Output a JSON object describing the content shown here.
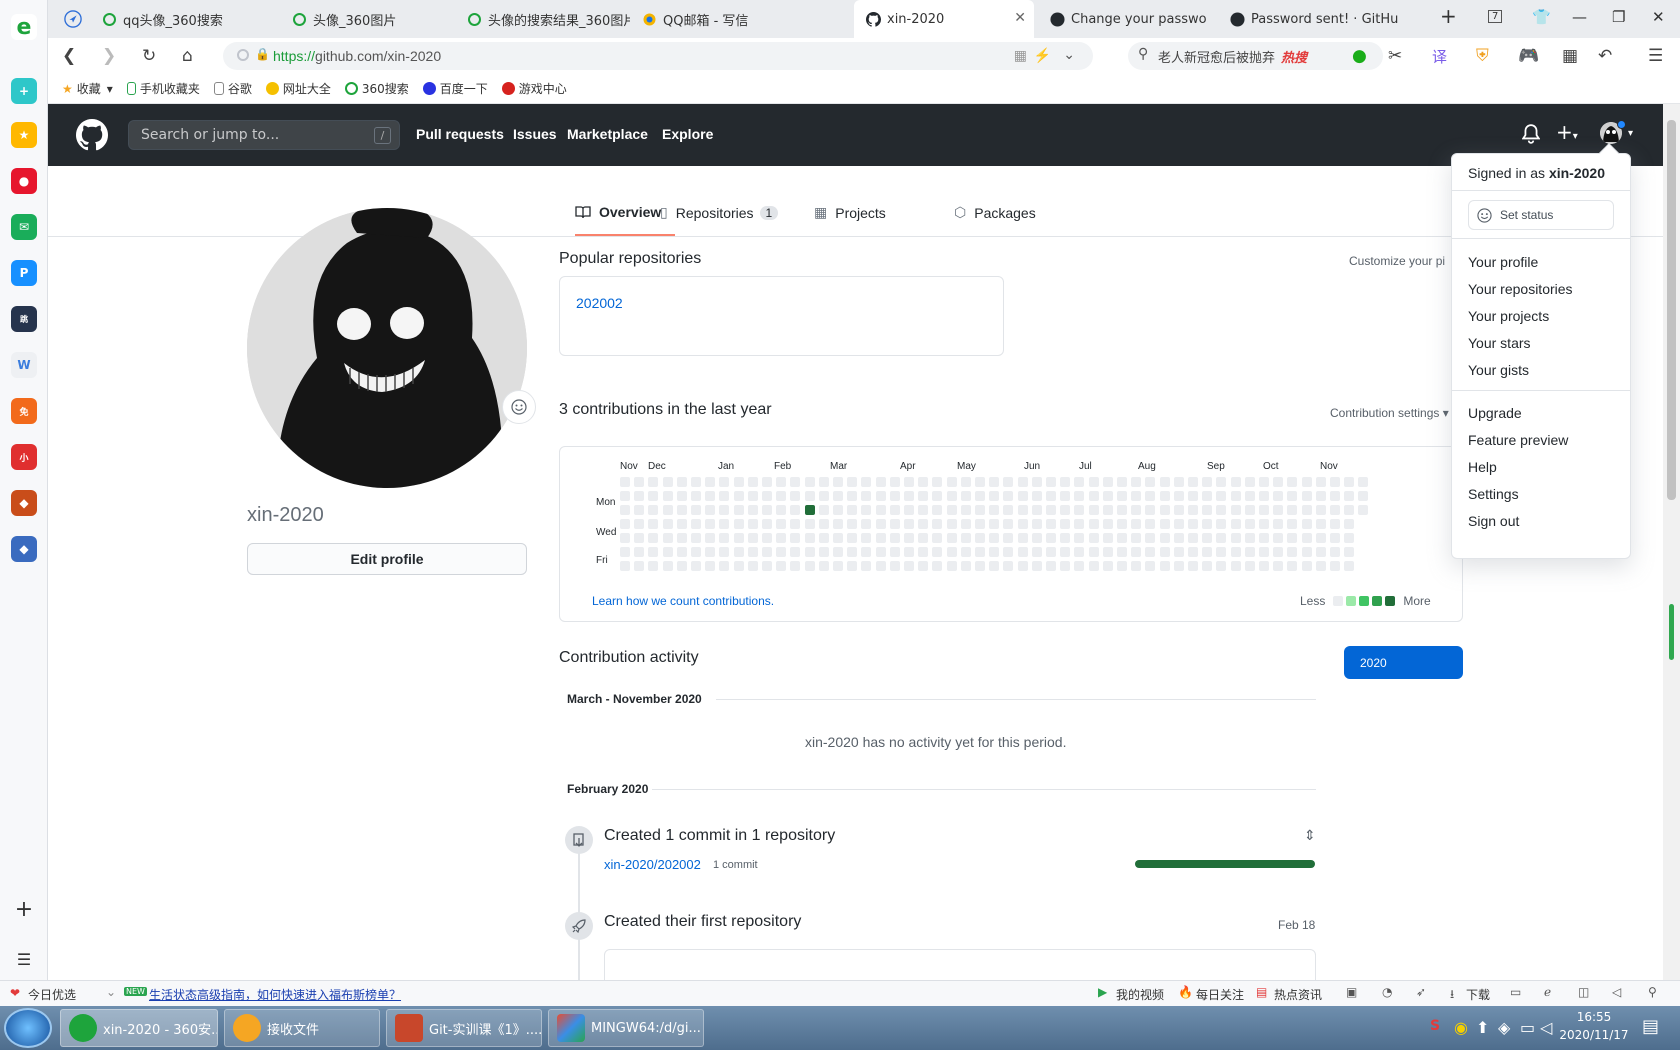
{
  "browser": {
    "tabs": [
      {
        "title": "qq头像_360搜索"
      },
      {
        "title": "头像_360图片"
      },
      {
        "title": "头像的搜索结果_360图片"
      },
      {
        "title": "QQ邮箱 - 写信"
      },
      {
        "title": "xin-2020"
      },
      {
        "title": "Change your passwo"
      },
      {
        "title": "Password sent! · GitHu"
      }
    ],
    "url_scheme": "https://",
    "url_rest": "github.com/xin-2020",
    "search_text": "老人新冠愈后被抛弃",
    "search_hot": "热搜",
    "bookmarks": [
      "收藏",
      "手机收藏夹",
      "谷歌",
      "网址大全",
      "360搜索",
      "百度一下",
      "游戏中心"
    ]
  },
  "github": {
    "search_placeholder": "Search or jump to...",
    "search_shortcut": "/",
    "nav": [
      "Pull requests",
      "Issues",
      "Marketplace",
      "Explore"
    ]
  },
  "profile": {
    "tabs": [
      {
        "label": "Overview",
        "active": true
      },
      {
        "label": "Repositories",
        "count": "1"
      },
      {
        "label": "Projects"
      },
      {
        "label": "Packages"
      }
    ],
    "username": "xin-2020",
    "edit_button": "Edit profile",
    "popular_title": "Popular repositories",
    "customize": "Customize your pi",
    "repo_name": "202002",
    "contrib_title": "3 contributions in the last year",
    "contrib_settings": "Contribution settings",
    "months": [
      "Nov",
      "Dec",
      "Jan",
      "Feb",
      "Mar",
      "Apr",
      "May",
      "Jun",
      "Jul",
      "Aug",
      "Sep",
      "Oct",
      "Nov"
    ],
    "days": [
      "Mon",
      "Wed",
      "Fri"
    ],
    "learn_link": "Learn how we count contributions.",
    "less": "Less",
    "more": "More",
    "activity_title": "Contribution activity",
    "year_button": "2020",
    "period1": "March - November 2020",
    "no_activity": "xin-2020 has no activity yet for this period.",
    "period2": "February 2020",
    "commit_title": "Created 1 commit in 1 repository",
    "commit_repo": "xin-2020/202002",
    "commit_count": "1 commit",
    "first_repo_title": "Created their first repository",
    "first_repo_date": "Feb 18"
  },
  "dropdown": {
    "signed_in_prefix": "Signed in as",
    "signed_in_user": "xin-2020",
    "set_status": "Set status",
    "items1": [
      "Your profile",
      "Your repositories",
      "Your projects",
      "Your stars",
      "Your gists"
    ],
    "items2": [
      "Upgrade",
      "Feature preview",
      "Help",
      "Settings",
      "Sign out"
    ]
  },
  "statusbar": {
    "left1": "今日优选",
    "new_badge": "NEW",
    "news": "生活状态高级指南，如何快速进入福布斯榜单？",
    "right": [
      "我的视频",
      "每日关注",
      "热点资讯",
      "下载"
    ]
  },
  "taskbar": {
    "apps": [
      "xin-2020 - 360安...",
      "接收文件",
      "Git-实训课《1》....",
      "MINGW64:/d/gi..."
    ],
    "time": "16:55",
    "date": "2020/11/17"
  },
  "colors": {
    "github_dark": "#24292e",
    "link": "#0366d6",
    "contrib_green": "#216e39",
    "year_blue": "#0366d6"
  }
}
